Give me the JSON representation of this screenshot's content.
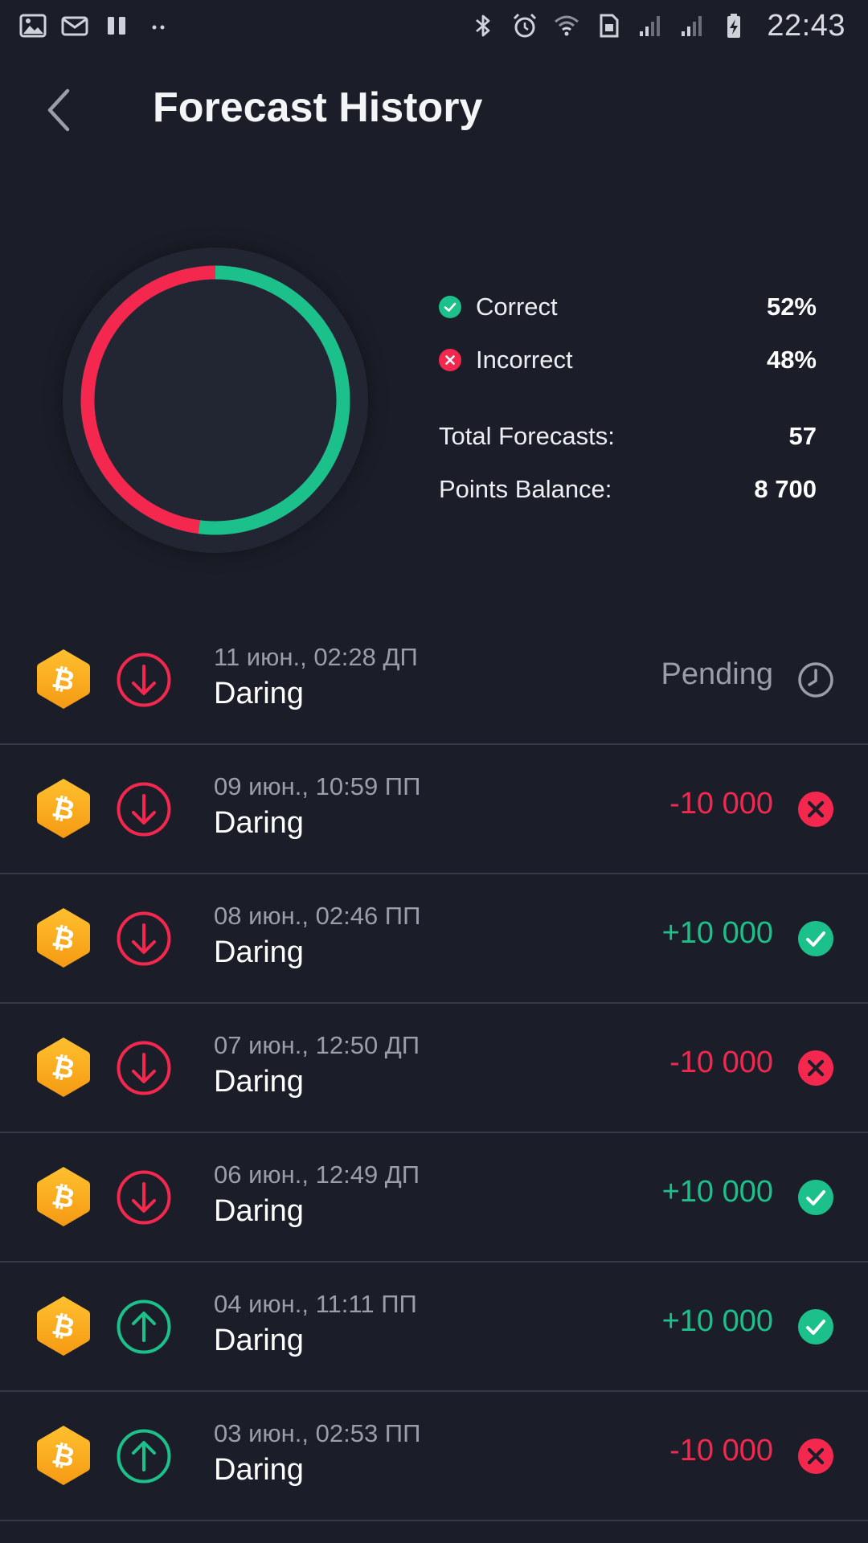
{
  "status_bar": {
    "time": "22:43",
    "left_icons": [
      "gallery-icon",
      "mail-icon",
      "pause-icon",
      "more-dots-icon"
    ],
    "right_icons": [
      "bluetooth-icon",
      "alarm-icon",
      "wifi-icon",
      "sim-icon",
      "signal-icon",
      "signal-icon",
      "battery-charging-icon"
    ]
  },
  "header": {
    "title": "Forecast History"
  },
  "summary": {
    "correct_label": "Correct",
    "correct_value": "52%",
    "correct_fraction": 0.52,
    "incorrect_label": "Incorrect",
    "incorrect_value": "48%",
    "total_label": "Total Forecasts:",
    "total_value": "57",
    "points_label": "Points Balance:",
    "points_value": "8 700",
    "colors": {
      "correct": "#1cc08a",
      "incorrect": "#f4284f"
    }
  },
  "forecasts": [
    {
      "date": "11 июн., 02:28 ДП",
      "name": "Daring",
      "direction": "down",
      "amount": "Pending",
      "status": "pending"
    },
    {
      "date": "09 июн., 10:59 ПП",
      "name": "Daring",
      "direction": "down",
      "amount": "-10 000",
      "status": "incorrect"
    },
    {
      "date": "08 июн., 02:46 ПП",
      "name": "Daring",
      "direction": "down",
      "amount": "+10 000",
      "status": "correct"
    },
    {
      "date": "07 июн., 12:50 ДП",
      "name": "Daring",
      "direction": "down",
      "amount": "-10 000",
      "status": "incorrect"
    },
    {
      "date": "06 июн., 12:49 ДП",
      "name": "Daring",
      "direction": "down",
      "amount": "+10 000",
      "status": "correct"
    },
    {
      "date": "04 июн., 11:11 ПП",
      "name": "Daring",
      "direction": "up",
      "amount": "+10 000",
      "status": "correct"
    },
    {
      "date": "03 июн., 02:53 ПП",
      "name": "Daring",
      "direction": "up",
      "amount": "-10 000",
      "status": "incorrect"
    }
  ]
}
